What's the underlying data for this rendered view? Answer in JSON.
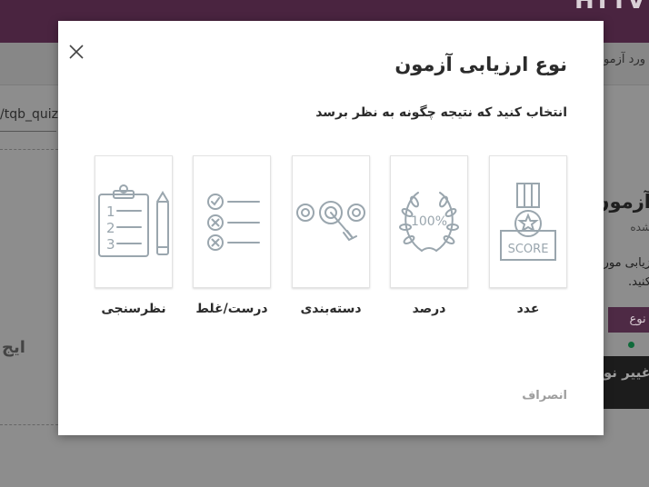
{
  "background": {
    "header_text": "HTTV",
    "breadcrumb": "ورد آزمون",
    "url_value": "/tqb_quiz",
    "dashed_text": "ایج",
    "right_title": "آزمون",
    "right_subtitle": "شده",
    "right_desc_line1": "زیابی مورد",
    "right_desc_line2": "کنید.",
    "right_button": "ر نوع",
    "right_dark_button": "غییر نوع"
  },
  "modal": {
    "title": "نوع ارزیابی آزمون",
    "subtitle": "انتخاب کنید که نتیجه چگونه به نظر برسد",
    "cancel_label": "انصراف",
    "close_icon": "close-icon",
    "options": [
      {
        "label": "عدد",
        "icon": "score-medal-icon",
        "icon_text": "SCORE"
      },
      {
        "label": "درصد",
        "icon": "percent-wreath-icon",
        "icon_text": "100%"
      },
      {
        "label": "دسته‌بندی",
        "icon": "target-arrow-icon"
      },
      {
        "label": "درست/غلط",
        "icon": "checklist-icon"
      },
      {
        "label": "نظرسنجی",
        "icon": "clipboard-survey-icon"
      }
    ]
  },
  "colors": {
    "icon_stroke": "#9aa6ae",
    "header_bg": "#4a2440",
    "overlay_bg": "#8f8f8f"
  }
}
